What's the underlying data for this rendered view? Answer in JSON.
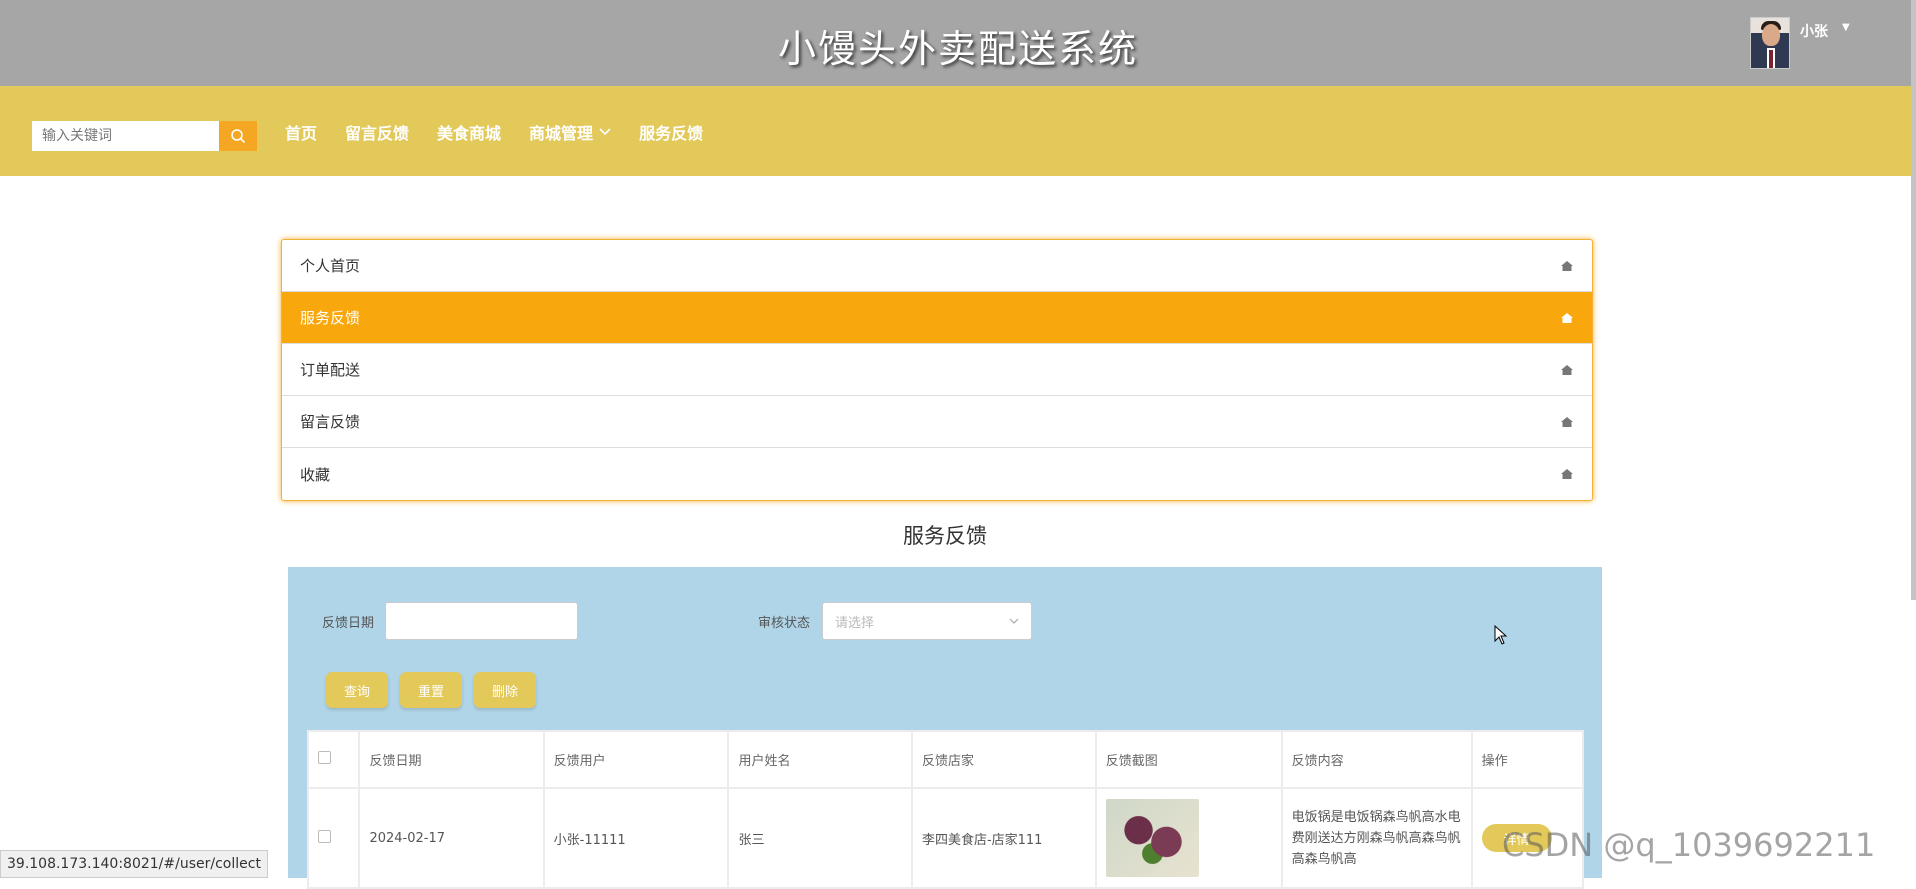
{
  "header": {
    "title": "小馒头外卖配送系统",
    "username": "小张"
  },
  "search": {
    "placeholder": "输入关键词"
  },
  "nav": {
    "items": [
      "首页",
      "留言反馈",
      "美食商城",
      "商城管理",
      "服务反馈"
    ]
  },
  "side_menu": {
    "items": [
      "个人首页",
      "服务反馈",
      "订单配送",
      "留言反馈",
      "收藏"
    ],
    "active_index": 1
  },
  "section": {
    "title": "服务反馈"
  },
  "filters": {
    "date_label": "反馈日期",
    "status_label": "审核状态",
    "status_placeholder": "请选择"
  },
  "buttons": {
    "query": "查询",
    "reset": "重置",
    "delete": "删除"
  },
  "table": {
    "headers": [
      "反馈日期",
      "反馈用户",
      "用户姓名",
      "反馈店家",
      "反馈截图",
      "反馈内容",
      "操作"
    ],
    "rows": [
      {
        "date": "2024-02-17",
        "user": "小张-11111",
        "name": "张三",
        "shop": "李四美食店-店家111",
        "content": "电饭锅是电饭锅森鸟帆高水电费刚送达方刚森鸟帆高森鸟帆高森鸟帆高",
        "action": "详情"
      }
    ]
  },
  "status_bar": {
    "url": "39.108.173.140:8021/#/user/collect"
  },
  "watermark": "CSDN @q_1039692211",
  "colors": {
    "header_bg": "#a6a6a6",
    "nav_bg": "#e3c95a",
    "accent": "#f8a80c",
    "panel_bg": "#b0d5e8"
  }
}
